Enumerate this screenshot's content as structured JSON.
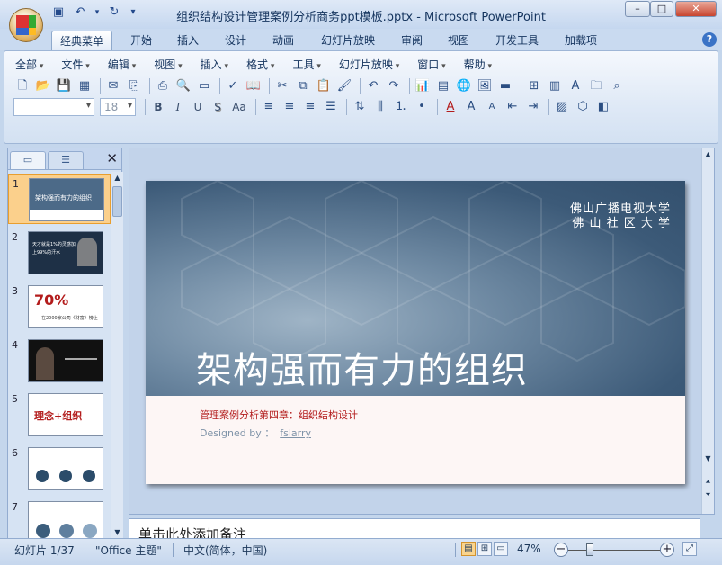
{
  "window": {
    "title": "组织结构设计管理案例分析商务ppt模板.pptx - Microsoft PowerPoint",
    "min": "–",
    "max": "□",
    "close": "✕"
  },
  "qat": {
    "save_icon": "save-icon",
    "undo_icon": "undo-icon",
    "redo_icon": "redo-icon",
    "more": "▾"
  },
  "tabs": [
    "经典菜单",
    "开始",
    "插入",
    "设计",
    "动画",
    "幻灯片放映",
    "审阅",
    "视图",
    "开发工具",
    "加载项"
  ],
  "active_tab": "经典菜单",
  "menus": [
    "全部",
    "文件",
    "编辑",
    "视图",
    "插入",
    "格式",
    "工具",
    "幻灯片放映",
    "窗口",
    "帮助"
  ],
  "font": {
    "name": "",
    "size": "18"
  },
  "format_buttons": {
    "bold": "B",
    "italic": "I",
    "underline": "U",
    "shadow": "S",
    "case": "Aa"
  },
  "panel": {
    "tab_slides_icon": "slides-tab-icon",
    "tab_outline_icon": "outline-tab-icon",
    "close": "✕"
  },
  "thumbs": [
    {
      "num": "1",
      "text": "架构强而有力的组织"
    },
    {
      "num": "2",
      "text": "天才就是1%的灵感加上99%的汗水"
    },
    {
      "num": "3",
      "text": "70%",
      "sub": "在2000家公司《财富》榜上"
    },
    {
      "num": "4",
      "text": ""
    },
    {
      "num": "5",
      "text": "理念+组织"
    },
    {
      "num": "6",
      "text": ""
    },
    {
      "num": "7",
      "text": ""
    }
  ],
  "slide": {
    "university_line1": "佛山广播电视大学",
    "university_line2": "佛 山 社 区 大 学",
    "title": "架构强而有力的组织",
    "subtitle": "管理案例分析第四章：组织结构设计",
    "designed_by": "Designed by ：",
    "author": "fslarry"
  },
  "notes": {
    "placeholder": "单击此处添加备注"
  },
  "status": {
    "slide_info": "幻灯片 1/37",
    "theme": "\"Office 主题\"",
    "language": "中文(简体，中国)",
    "zoom": "47%",
    "zoom_level": 0.47
  },
  "colors": {
    "accent_red": "#b31c1c",
    "slide_blue": "#3c5a78",
    "selection_orange": "#fbd08c"
  }
}
